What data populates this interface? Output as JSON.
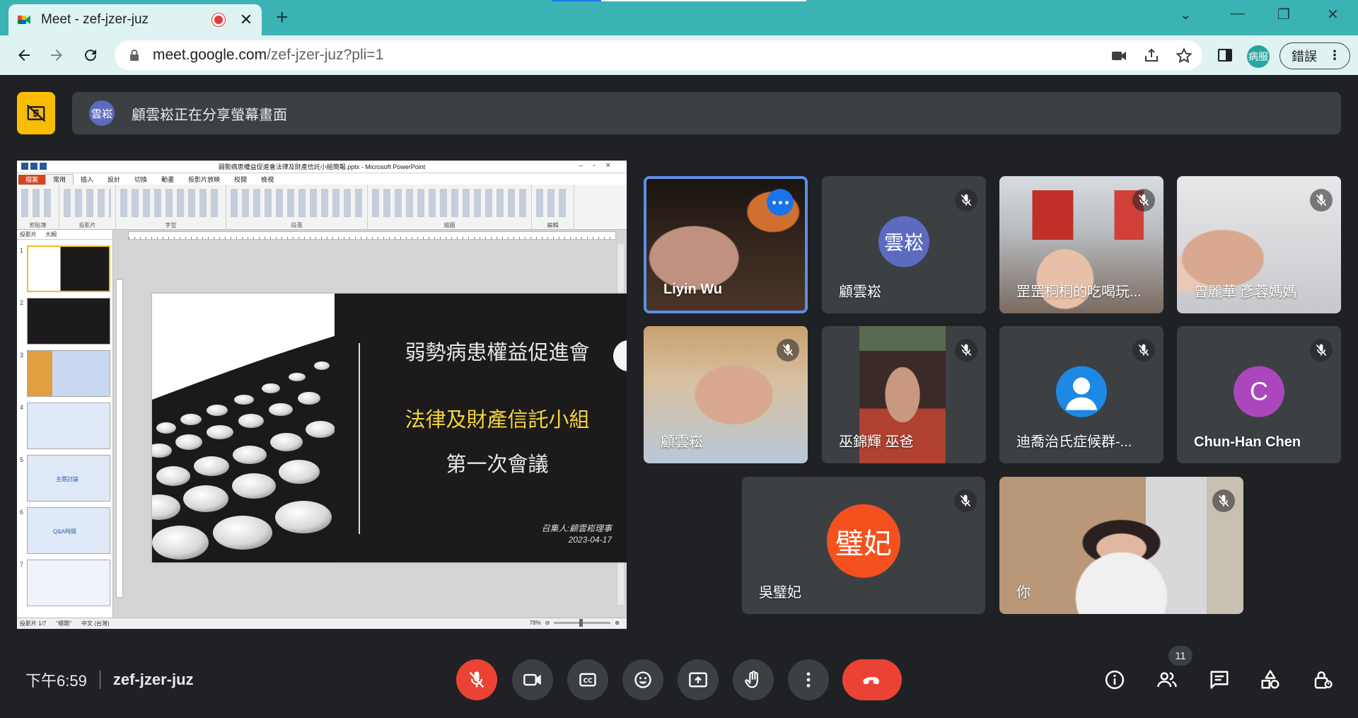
{
  "browser": {
    "tab_title": "Meet - zef-jzer-juz",
    "url_host": "meet.google.com",
    "url_path": "/zef-jzer-juz?pli=1",
    "profile_initials": "病服",
    "error_chip": "錯誤"
  },
  "banner": {
    "presenter_initials": "雲崧",
    "message": "顧雲崧正在分享螢幕畫面"
  },
  "ppt": {
    "window_title": "弱勢病患權益促進會法律及財產信託小組簡報.pptx - Microsoft PowerPoint",
    "tabs": [
      "檔案",
      "常用",
      "插入",
      "設計",
      "切換",
      "動畫",
      "投影片放映",
      "校閱",
      "檢視"
    ],
    "groups": [
      "剪貼簿",
      "投影片",
      "字型",
      "段落",
      "繪圖",
      "編輯"
    ],
    "pane_tabs": [
      "投影片",
      "大綱"
    ],
    "thumb_numbers": [
      "1",
      "2",
      "3",
      "4",
      "5",
      "6",
      "7"
    ],
    "thumb_labels": {
      "t5": "主題討論",
      "t6": "Q&A時間"
    },
    "slide": {
      "title1": "弱勢病患權益促進會",
      "title2": "法律及財產信託小組",
      "title3": "第一次會議",
      "convener": "召集人:顧雲崧理事",
      "date": "2023-04-17"
    },
    "status_left": "投影片 1/7",
    "status_theme": "\"標題\"",
    "status_lang": "中文 (台灣)",
    "zoom": "78%"
  },
  "participants": [
    {
      "name": "Liyin Wu",
      "type": "video",
      "speaking": true
    },
    {
      "name": "顧雲崧",
      "type": "avatar",
      "initials": "雲崧",
      "color": "#5c6bc0",
      "muted": true
    },
    {
      "name": "罡罡桐桐的吃喝玩...",
      "type": "video",
      "muted": true
    },
    {
      "name": "曾麗華 彥蓉媽媽",
      "type": "video",
      "muted": true
    },
    {
      "name": "顧雲崧",
      "type": "video",
      "muted": true
    },
    {
      "name": "巫錦輝 巫爸",
      "type": "video",
      "muted": true
    },
    {
      "name": "迪喬治氏症候群-...",
      "type": "avatar",
      "initials": "",
      "color": "#1e88e5",
      "muted": true
    },
    {
      "name": "Chun-Han Chen",
      "type": "avatar",
      "initials": "C",
      "color": "#ab47bc",
      "muted": true
    },
    {
      "name": "吳璧妃",
      "type": "avatar",
      "initials": "璧妃",
      "color": "#f4511e",
      "muted": true
    },
    {
      "name": "你",
      "type": "video",
      "muted": true
    }
  ],
  "footer": {
    "time": "下午6:59",
    "meeting_code": "zef-jzer-juz",
    "people_count": "11"
  },
  "colors": {
    "meet_bg": "#202124",
    "tile_bg": "#3c4043",
    "end_call": "#ea4335",
    "present_badge": "#fbbc04",
    "chrome_accent": "#3bb2b4"
  }
}
